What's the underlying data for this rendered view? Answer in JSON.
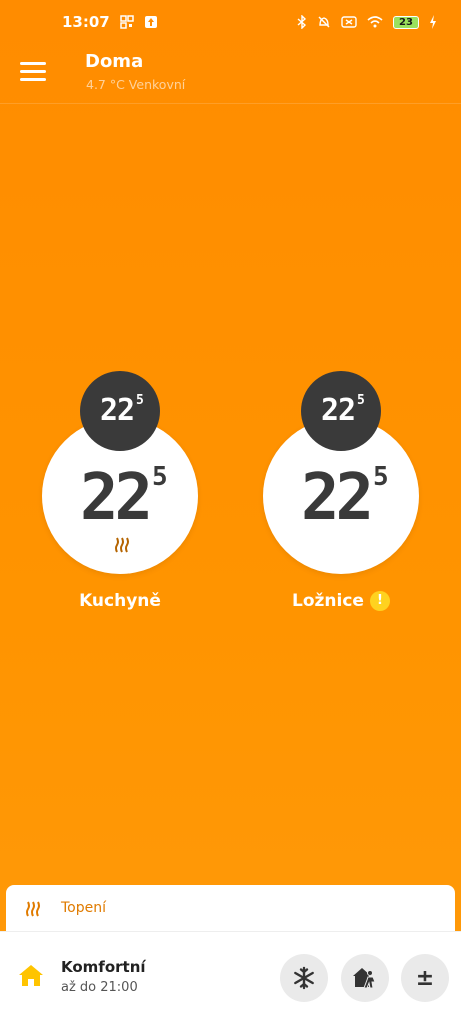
{
  "status": {
    "time": "13:07",
    "battery": "23"
  },
  "header": {
    "title": "Doma",
    "subtitle": "4.7 °C Venkovní"
  },
  "rooms": [
    {
      "name": "Kuchyně",
      "target_temp": "22",
      "target_decimal": "5",
      "current_temp": "22",
      "current_decimal": "5",
      "heating": true,
      "warning": false
    },
    {
      "name": "Ložnice",
      "target_temp": "22",
      "target_decimal": "5",
      "current_temp": "22",
      "current_decimal": "5",
      "heating": false,
      "warning": true,
      "warning_symbol": "!"
    }
  ],
  "heating_strip": {
    "label": "Topení"
  },
  "bottom": {
    "mode": "Komfortní",
    "until": "až do 21:00",
    "adjust_symbol": "±"
  },
  "colors": {
    "background": "#ff9500",
    "dark_circle": "#3a3a3a",
    "accent": "#e07b00",
    "warning": "#ffd21f",
    "home_icon": "#ffc400"
  },
  "icons": [
    "menu-icon",
    "heat-icon",
    "warning-icon",
    "home-icon",
    "snowflake-icon",
    "away-icon",
    "plus-minus-icon"
  ]
}
